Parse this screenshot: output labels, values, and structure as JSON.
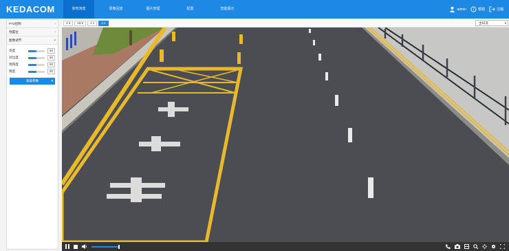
{
  "app": {
    "logo": "KEDACOM"
  },
  "nav": {
    "items": [
      {
        "label": "实时浏览",
        "active": true
      },
      {
        "label": "录像回放",
        "active": false
      },
      {
        "label": "图片管理",
        "active": false
      },
      {
        "label": "配置",
        "active": false
      },
      {
        "label": "智能展示",
        "active": false
      }
    ]
  },
  "user": {
    "name": "admin",
    "help": "帮助",
    "logout": "注销"
  },
  "sidebar": {
    "sections": [
      {
        "label": "PTZ控制"
      },
      {
        "label": "预置位"
      },
      {
        "label": "图像调节"
      }
    ],
    "sliders": [
      {
        "label": "亮度",
        "value": "50"
      },
      {
        "label": "对比度",
        "value": "50"
      },
      {
        "label": "饱和度",
        "value": "50"
      },
      {
        "label": "锐度",
        "value": "50"
      }
    ],
    "advanced_button": "高级参数"
  },
  "toolbar": {
    "ratios": [
      "4:3",
      "16:9",
      "1:1",
      "1:1"
    ],
    "stream_select": "主码流"
  },
  "colors": {
    "accent": "#1e88e5",
    "nav_active": "#0b6fcf",
    "road": "#4a4c50",
    "marking_yellow": "#e8b92c"
  },
  "controls": {
    "left_icons": [
      "pause-icon",
      "stop-icon",
      "volume-icon"
    ],
    "volume_level": 1.0,
    "right_icons": [
      "phone-icon",
      "snapshot-icon",
      "record-icon",
      "zoom-icon",
      "ptz-icon",
      "settings-icon",
      "fullscreen-icon"
    ]
  }
}
